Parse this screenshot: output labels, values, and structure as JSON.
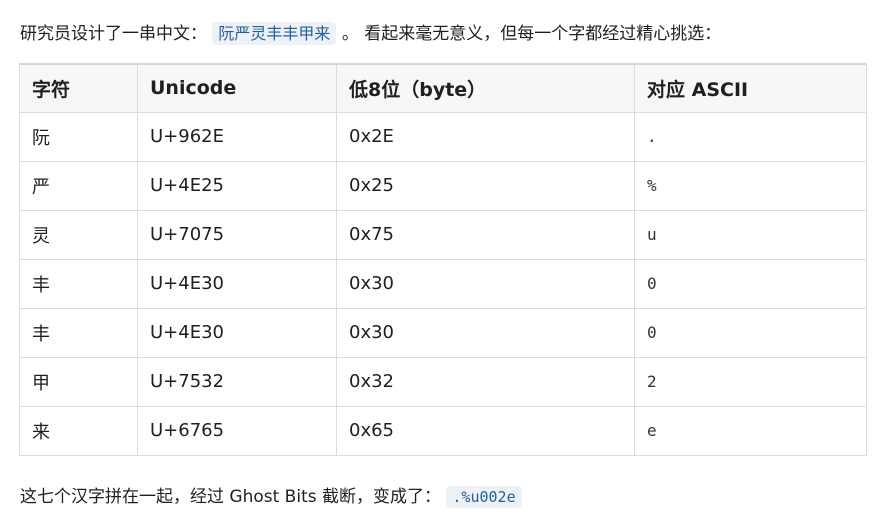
{
  "intro": {
    "text_before": "研究员设计了一串中文：",
    "code": "阮严灵丰丰甲来",
    "text_after": "。 看起来毫无意义，但每一个字都经过精心挑选："
  },
  "table": {
    "headers": [
      "字符",
      "Unicode",
      "低8位（byte）",
      "对应 ASCII"
    ],
    "rows": [
      [
        "阮",
        "U+962E",
        "0x2E",
        "."
      ],
      [
        "严",
        "U+4E25",
        "0x25",
        "%"
      ],
      [
        "灵",
        "U+7075",
        "0x75",
        "u"
      ],
      [
        "丰",
        "U+4E30",
        "0x30",
        "0"
      ],
      [
        "丰",
        "U+4E30",
        "0x30",
        "0"
      ],
      [
        "甲",
        "U+7532",
        "0x32",
        "2"
      ],
      [
        "来",
        "U+6765",
        "0x65",
        "e"
      ]
    ]
  },
  "outro": {
    "text_before": "这七个汉字拼在一起，经过 Ghost Bits 截断，变成了：",
    "code": ".%u002e"
  }
}
